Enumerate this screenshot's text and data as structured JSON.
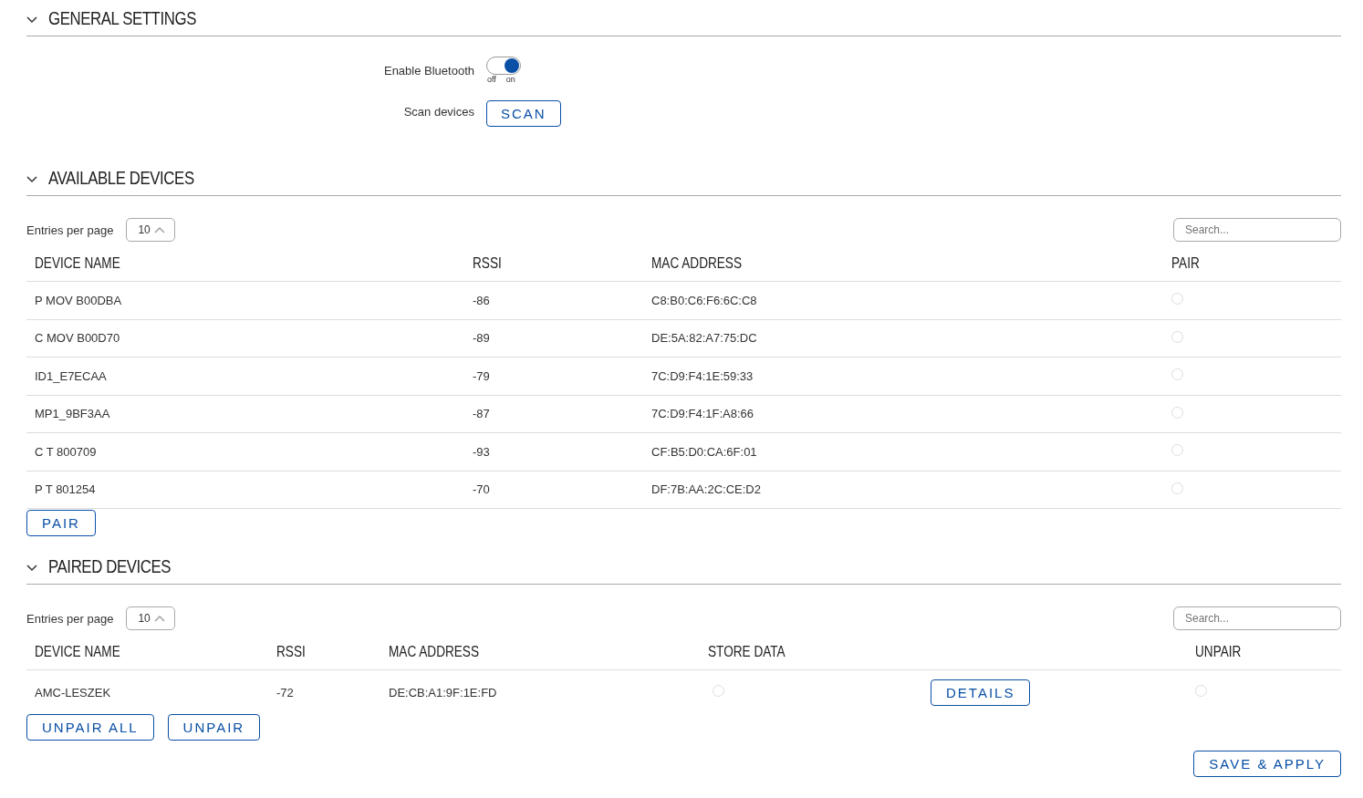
{
  "general": {
    "title": "GENERAL SETTINGS",
    "expanded": true,
    "bluetooth": {
      "label": "Enable Bluetooth",
      "on": true,
      "off_text": "off",
      "on_text": "on"
    },
    "scan": {
      "label": "Scan devices",
      "button": "SCAN"
    }
  },
  "available": {
    "title": "AVAILABLE DEVICES",
    "expanded": true,
    "entries_label": "Entries per page",
    "entries_value": "10",
    "search": {
      "placeholder": "Search..."
    },
    "columns": [
      "DEVICE NAME",
      "RSSI",
      "MAC ADDRESS",
      "PAIR"
    ],
    "rows": [
      {
        "name": "P MOV B00DBA",
        "rssi": "-86",
        "mac": "C8:B0:C6:F6:6C:C8",
        "selected": false
      },
      {
        "name": "C MOV B00D70",
        "rssi": "-89",
        "mac": "DE:5A:82:A7:75:DC",
        "selected": false
      },
      {
        "name": "ID1_E7ECAA",
        "rssi": "-79",
        "mac": "7C:D9:F4:1E:59:33",
        "selected": false
      },
      {
        "name": "MP1_9BF3AA",
        "rssi": "-87",
        "mac": "7C:D9:F4:1F:A8:66",
        "selected": false
      },
      {
        "name": "C T 800709",
        "rssi": "-93",
        "mac": "CF:B5:D0:CA:6F:01",
        "selected": false
      },
      {
        "name": "P T 801254",
        "rssi": "-70",
        "mac": "DF:7B:AA:2C:CE:D2",
        "selected": false
      }
    ],
    "button": "PAIR"
  },
  "paired": {
    "title": "PAIRED DEVICES",
    "expanded": true,
    "entries_label": "Entries per page",
    "entries_value": "10",
    "search": {
      "placeholder": "Search..."
    },
    "columns": [
      "DEVICE NAME",
      "RSSI",
      "MAC ADDRESS",
      "STORE DATA",
      "UNPAIR"
    ],
    "rows": [
      {
        "name": "AMC-LESZEK",
        "rssi": "-72",
        "mac": "DE:CB:A1:9F:1E:FD",
        "store_data": false,
        "details": "DETAILS",
        "unpair": false
      }
    ],
    "buttons": [
      "UNPAIR ALL",
      "UNPAIR"
    ]
  },
  "save_button": "SAVE & APPLY"
}
